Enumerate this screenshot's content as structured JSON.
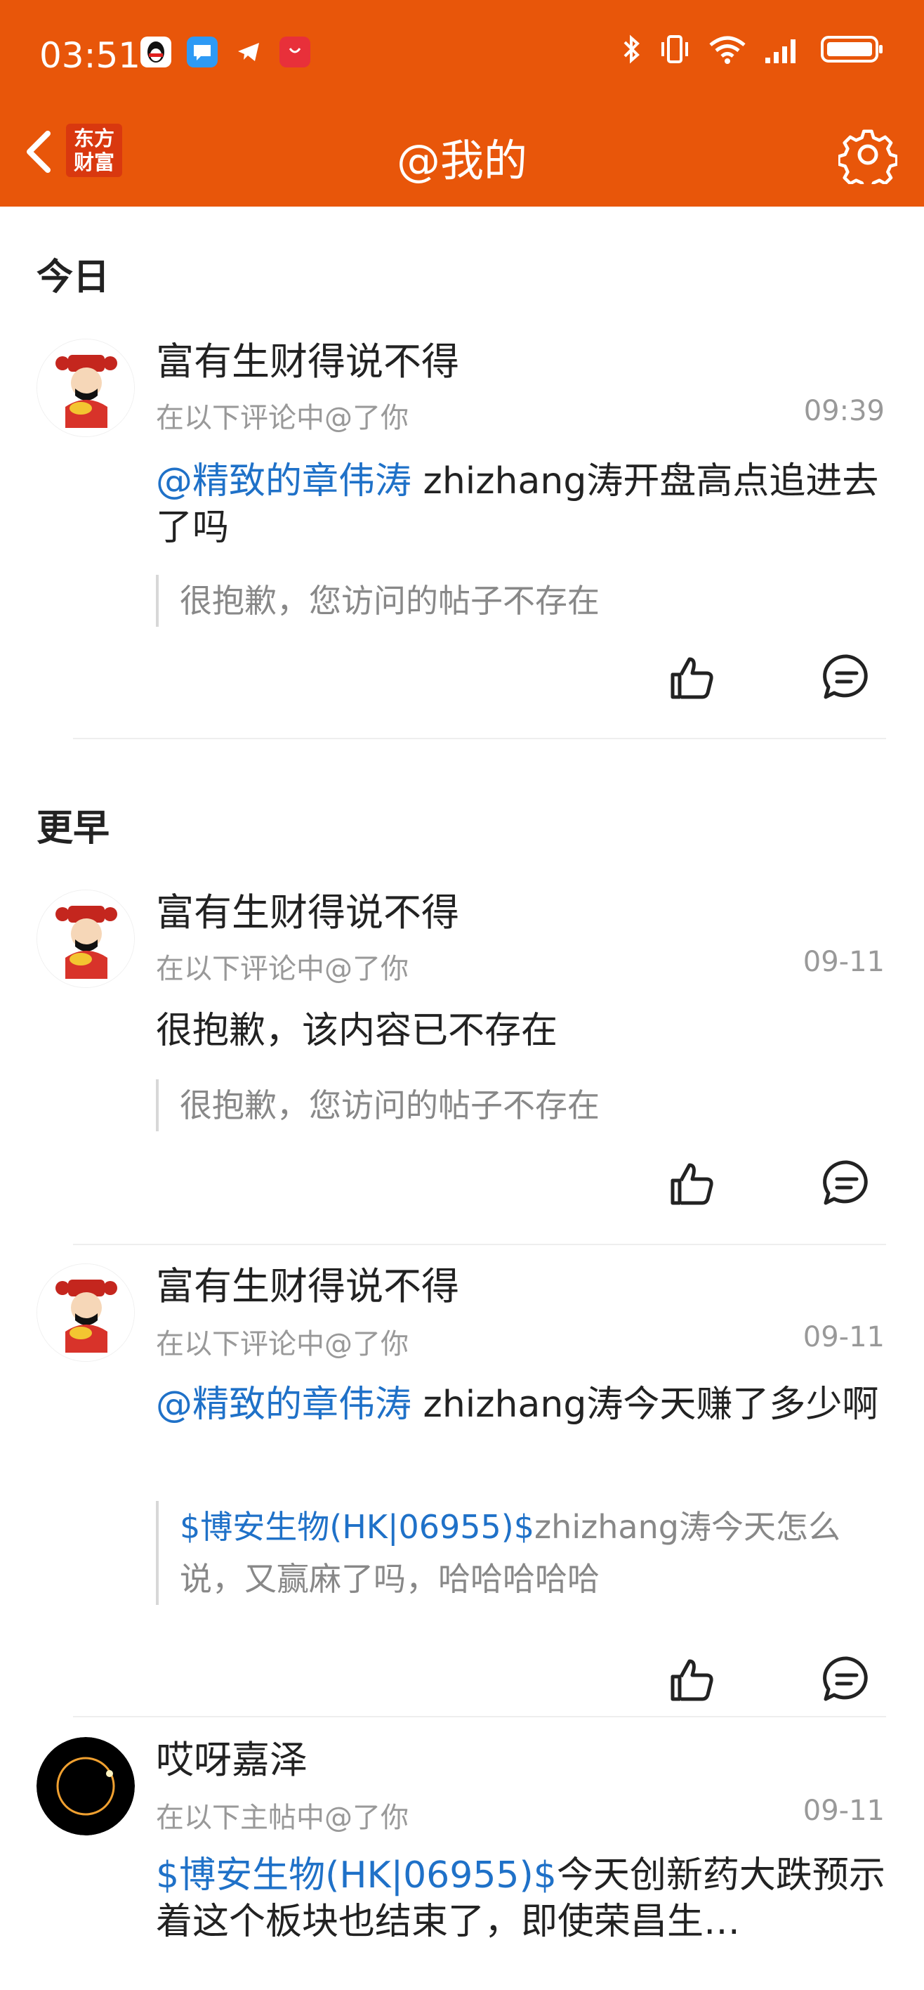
{
  "status_bar": {
    "time": "03:51",
    "notification_icons": [
      "qq-icon",
      "message-icon",
      "telegram-icon",
      "huawei-store-icon"
    ],
    "right_icons": [
      "bluetooth-icon",
      "vibrate-icon",
      "wifi-icon",
      "signal-icon",
      "battery-icon"
    ]
  },
  "header": {
    "logo_line1": "东方",
    "logo_line2": "财富",
    "title": "@我的",
    "accent_color": "#e8560a"
  },
  "sections": [
    {
      "label": "今日"
    },
    {
      "label": "更早"
    }
  ],
  "items": [
    {
      "author": "富有生财得说不得",
      "context": "在以下评论中@了你",
      "time": "09:39",
      "mention": "@精致的章伟涛",
      "text": " zhizhang涛开盘高点追进去了吗",
      "quote": "很抱歉，您访问的帖子不存在"
    },
    {
      "author": "富有生财得说不得",
      "context": "在以下评论中@了你",
      "time": "09-11",
      "text": " 很抱歉，该内容已不存在",
      "quote": "很抱歉，您访问的帖子不存在"
    },
    {
      "author": "富有生财得说不得",
      "context": "在以下评论中@了你",
      "time": "09-11",
      "mention": "@精致的章伟涛",
      "text": " zhizhang涛今天赚了多少啊",
      "quote_link": "$博安生物(HK|06955)$",
      "quote": "zhizhang涛今天怎么说，又赢麻了吗，哈哈哈哈哈"
    },
    {
      "author": "哎呀嘉泽",
      "context": "在以下主帖中@了你",
      "time": "09-11",
      "mention": "$博安生物(HK|06955)$",
      "text": "今天创新药大跌预示着这个板块也结束了，即使荣昌生…"
    }
  ],
  "colors": {
    "link": "#1f71c8",
    "meta": "#999999",
    "primary_text": "#222222"
  }
}
